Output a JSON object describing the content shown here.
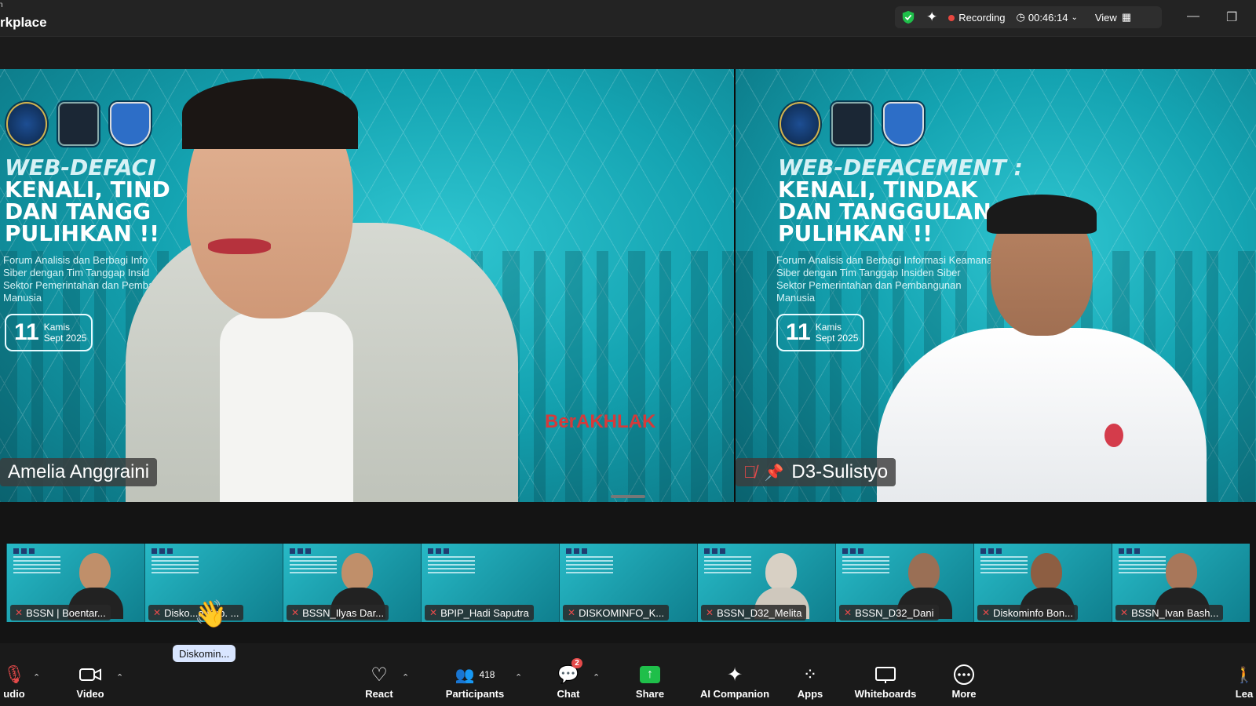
{
  "window": {
    "title_small": "n",
    "title": "rkplace"
  },
  "status": {
    "recording_label": "Recording",
    "timer": "00:46:14",
    "view_label": "View"
  },
  "slide": {
    "title_line1": "WEB-DEFACEMENT :",
    "title_line2": "KENALI, TINDAK",
    "title_line3": "DAN TANGGULANG",
    "title_line4": "PULIHKAN !!",
    "sub_line1": "Forum Analisis dan Berbagi Informasi Keamanan",
    "sub_line2": "Siber dengan Tim Tanggap Insiden Siber",
    "sub_line3": "Sektor Pemerintahan dan Pembangunan",
    "sub_line4": "Manusia",
    "date_num": "11",
    "date_day": "Kamis",
    "date_month": "Sept 2025",
    "brand": "BerAKHLAK",
    "left_title_line1": "WEB-DEFACI",
    "left_title_line2": "KENALI, TIND",
    "left_title_line3": "DAN TANGG",
    "left_sub_line1": "Forum Analisis dan Berbagi Info",
    "left_sub_line2": "Siber dengan Tim Tanggap Insid",
    "left_sub_line3": "Sektor Pemerintahan dan Pemba"
  },
  "speakers": [
    {
      "name": "Amelia Anggraini"
    },
    {
      "name": "D3-Sulistyo"
    }
  ],
  "thumbnails": [
    {
      "label": "BSSN | Boentar..."
    },
    {
      "label": "Disko...o Kab. ..."
    },
    {
      "label": "BSSN_Ilyas Dar..."
    },
    {
      "label": "BPIP_Hadi Saputra"
    },
    {
      "label": "DISKOMINFO_K..."
    },
    {
      "label": "BSSN_D32_Melita"
    },
    {
      "label": "BSSN_D32_Dani"
    },
    {
      "label": "Diskominfo Bon..."
    },
    {
      "label": "BSSN_Ivan Bash..."
    }
  ],
  "tooltip": "Diskomin...",
  "toolbar": {
    "audio": "udio",
    "video": "Video",
    "react": "React",
    "participants": "Participants",
    "participants_count": "418",
    "chat": "Chat",
    "chat_badge": "2",
    "share": "Share",
    "ai_companion": "AI Companion",
    "apps": "Apps",
    "whiteboards": "Whiteboards",
    "more": "More",
    "leave": "Lea"
  },
  "colors": {
    "accent_teal": "#14a3b1",
    "recording_red": "#e8473f",
    "muted_red": "#e54a4a",
    "share_green": "#1fbf4a"
  }
}
